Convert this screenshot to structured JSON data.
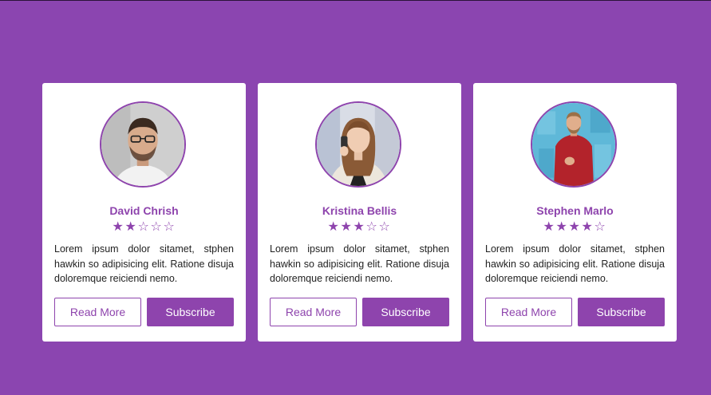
{
  "colors": {
    "background": "#8b45b0",
    "accent": "#8e44ad",
    "card": "#ffffff"
  },
  "cards": [
    {
      "name": "David Chrish",
      "rating": 2,
      "max_rating": 5,
      "description": "Lorem ipsum dolor sitamet, stphen hawkin so adipisicing elit. Ratione disuja doloremque reiciendi nemo.",
      "read_more_label": "Read More",
      "subscribe_label": "Subscribe",
      "avatar_icon": "man-with-glasses-avatar"
    },
    {
      "name": "Kristina Bellis",
      "rating": 3,
      "max_rating": 5,
      "description": "Lorem ipsum dolor sitamet, stphen hawkin so adipisicing elit. Ratione disuja doloremque reiciendi nemo.",
      "read_more_label": "Read More",
      "subscribe_label": "Subscribe",
      "avatar_icon": "woman-on-phone-avatar"
    },
    {
      "name": "Stephen Marlo",
      "rating": 4,
      "max_rating": 5,
      "description": "Lorem ipsum dolor sitamet, stphen hawkin so adipisicing elit. Ratione disuja doloremque reiciendi nemo.",
      "read_more_label": "Read More",
      "subscribe_label": "Subscribe",
      "avatar_icon": "man-red-sweater-avatar"
    }
  ]
}
